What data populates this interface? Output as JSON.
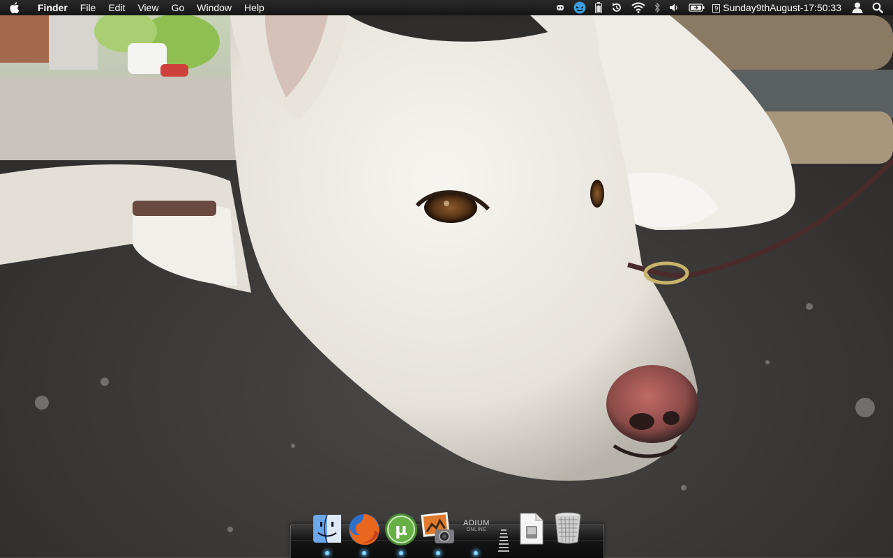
{
  "menubar": {
    "app_name": "Finder",
    "menus": [
      "File",
      "Edit",
      "View",
      "Go",
      "Window",
      "Help"
    ],
    "status_icons": [
      "growl-icon",
      "twitterrific-icon",
      "battery-icon",
      "time-machine-icon",
      "wifi-icon",
      "bluetooth-icon",
      "volume-icon",
      "battery-status-icon"
    ],
    "calendar_day": "9",
    "clock": "Sunday9thAugust-17:50:33",
    "user_icon": "user-icon",
    "spotlight_icon": "spotlight-icon"
  },
  "desktop": {
    "wallpaper": "white-dog-lying-on-asphalt"
  },
  "dock": {
    "items": [
      {
        "name": "Finder",
        "icon": "finder-icon",
        "running": true
      },
      {
        "name": "Firefox",
        "icon": "firefox-icon",
        "running": true
      },
      {
        "name": "uTorrent",
        "icon": "utorrent-icon",
        "running": true
      },
      {
        "name": "iPhoto",
        "icon": "iphoto-icon",
        "running": true
      },
      {
        "name": "Adium",
        "icon": "adium-icon",
        "running": true
      }
    ],
    "adium_label": "ADIUM",
    "adium_status": "ONLINE",
    "stack_item": {
      "icon": "document-stack-icon"
    },
    "trash": {
      "icon": "trash-icon"
    }
  },
  "colors": {
    "menubar_bg": "#1c1c1c",
    "dock_indicator": "#7fd8ff",
    "asphalt": "#3b3a38",
    "dog_fur": "#ece9e2",
    "leash": "#4a2a2a"
  }
}
